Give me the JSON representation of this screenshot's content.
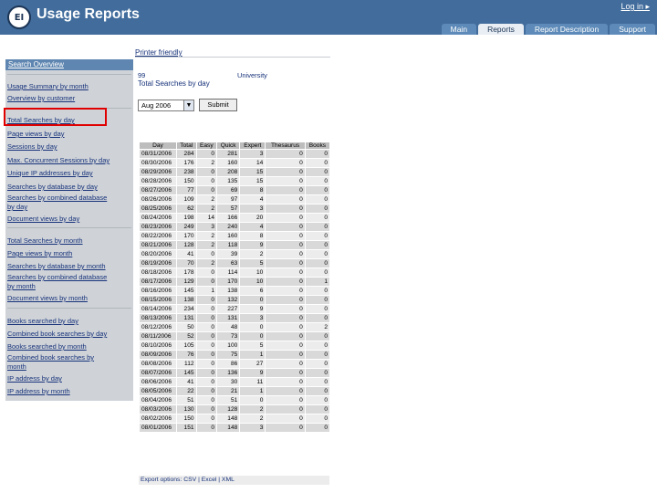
{
  "header": {
    "title": "Usage Reports",
    "logo_text": "EI",
    "login_label": "Log in ▸",
    "tabs": [
      "Main",
      "Reports",
      "Report Description",
      "Support"
    ]
  },
  "sidebar": {
    "title": "Search Overview",
    "group1": [
      "Usage Summary by month",
      "Overview by customer"
    ],
    "group2": [
      "Total Searches by day",
      "Page views by day",
      "Sessions by day",
      "Max. Concurrent Sessions by day",
      "Unique IP addresses by day",
      "Searches by database by day",
      "Searches by combined database",
      "by day",
      "Document views by day"
    ],
    "group3": [
      "Total Searches by month",
      "Page views by month",
      "Searches by database by month",
      "Searches by combined database",
      "by month",
      "Document views by month"
    ],
    "group4": [
      "Books searched by day",
      "Combined book searches by day",
      "Books searched by month",
      "Combined book searches by",
      "month",
      "IP address by day",
      "IP address by month"
    ]
  },
  "main": {
    "print_link": "Printer friendly",
    "institution_id": "99",
    "institution_name": "University",
    "report_name": "Total Searches by day",
    "month_value": "Aug 2006",
    "submit_label": "Submit",
    "export_text": "Export options: CSV | Excel | XML"
  },
  "table": {
    "headers": [
      "Day",
      "Total",
      "Easy",
      "Quick",
      "Expert",
      "Thesaurus",
      "Books"
    ],
    "rows": [
      [
        "08/31/2006",
        "284",
        "0",
        "281",
        "3",
        "0",
        "0"
      ],
      [
        "08/30/2006",
        "176",
        "2",
        "160",
        "14",
        "0",
        "0"
      ],
      [
        "08/29/2006",
        "238",
        "0",
        "208",
        "15",
        "0",
        "0"
      ],
      [
        "08/28/2006",
        "150",
        "0",
        "135",
        "15",
        "0",
        "0"
      ],
      [
        "08/27/2006",
        "77",
        "0",
        "69",
        "8",
        "0",
        "0"
      ],
      [
        "08/26/2006",
        "109",
        "2",
        "97",
        "4",
        "0",
        "0"
      ],
      [
        "08/25/2006",
        "62",
        "2",
        "57",
        "3",
        "0",
        "0"
      ],
      [
        "08/24/2006",
        "198",
        "14",
        "166",
        "20",
        "0",
        "0"
      ],
      [
        "08/23/2006",
        "249",
        "3",
        "240",
        "4",
        "0",
        "0"
      ],
      [
        "08/22/2006",
        "170",
        "2",
        "160",
        "8",
        "0",
        "0"
      ],
      [
        "08/21/2006",
        "128",
        "2",
        "118",
        "9",
        "0",
        "0"
      ],
      [
        "08/20/2006",
        "41",
        "0",
        "39",
        "2",
        "0",
        "0"
      ],
      [
        "08/19/2006",
        "70",
        "2",
        "63",
        "5",
        "0",
        "0"
      ],
      [
        "08/18/2006",
        "178",
        "0",
        "114",
        "10",
        "0",
        "0"
      ],
      [
        "08/17/2006",
        "129",
        "0",
        "170",
        "10",
        "0",
        "1"
      ],
      [
        "08/16/2006",
        "145",
        "1",
        "138",
        "6",
        "0",
        "0"
      ],
      [
        "08/15/2006",
        "138",
        "0",
        "132",
        "0",
        "0",
        "0"
      ],
      [
        "08/14/2006",
        "234",
        "0",
        "227",
        "9",
        "0",
        "0"
      ],
      [
        "08/13/2006",
        "131",
        "0",
        "131",
        "3",
        "0",
        "0"
      ],
      [
        "08/12/2006",
        "50",
        "0",
        "48",
        "0",
        "0",
        "2"
      ],
      [
        "08/11/2006",
        "52",
        "0",
        "73",
        "0",
        "0",
        "0"
      ],
      [
        "08/10/2006",
        "105",
        "0",
        "100",
        "5",
        "0",
        "0"
      ],
      [
        "08/09/2006",
        "76",
        "0",
        "75",
        "1",
        "0",
        "0"
      ],
      [
        "08/08/2006",
        "112",
        "0",
        "86",
        "27",
        "0",
        "0"
      ],
      [
        "08/07/2006",
        "145",
        "0",
        "136",
        "9",
        "0",
        "0"
      ],
      [
        "08/06/2006",
        "41",
        "0",
        "30",
        "11",
        "0",
        "0"
      ],
      [
        "08/05/2006",
        "22",
        "0",
        "21",
        "1",
        "0",
        "0"
      ],
      [
        "08/04/2006",
        "51",
        "0",
        "51",
        "0",
        "0",
        "0"
      ],
      [
        "08/03/2006",
        "130",
        "0",
        "128",
        "2",
        "0",
        "0"
      ],
      [
        "08/02/2006",
        "150",
        "0",
        "148",
        "2",
        "0",
        "0"
      ],
      [
        "08/01/2006",
        "151",
        "0",
        "148",
        "3",
        "0",
        "0"
      ]
    ]
  }
}
